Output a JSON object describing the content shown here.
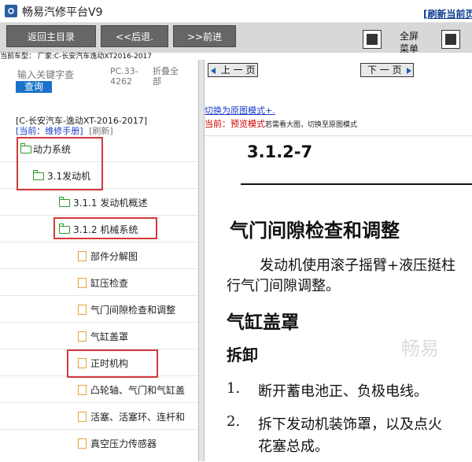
{
  "app": {
    "title": "畅易汽修平台V9"
  },
  "toolbar": {
    "home_label": "返回主目录",
    "back_label": "<<后退.",
    "forward_label": ">>前进",
    "fullscreen_label_1": "全屏",
    "fullscreen_label_2": "菜单"
  },
  "car_type": "当前车型： 厂家:C-长安汽车逸动XT2016-2017",
  "search": {
    "placeholder_line1": "输入关键字查",
    "placeholder_line2": "查询",
    "code_line1": "PC.33-",
    "code_line2": "4262",
    "collapse_line1": "折叠全",
    "collapse_line2": "部"
  },
  "breadcrumb": {
    "model": "[C-长安汽车-逸动XT-2016-2017]",
    "current_prefix": "[当前：",
    "current": "维修手册",
    "current_suffix": "]",
    "refresh": "[刷新]"
  },
  "tree": [
    {
      "label": "动力系统",
      "kind": "folder"
    },
    {
      "label": "3.1发动机",
      "kind": "folder"
    },
    {
      "label": "3.1.1 发动机概述",
      "kind": "folder"
    },
    {
      "label": "3.1.2 机械系统",
      "kind": "folder"
    },
    {
      "label": "部件分解图",
      "kind": "page"
    },
    {
      "label": "缸压检查",
      "kind": "page"
    },
    {
      "label": "气门间隙检查和调整",
      "kind": "page"
    },
    {
      "label": "气缸盖罩",
      "kind": "page"
    },
    {
      "label": "正时机构",
      "kind": "page"
    },
    {
      "label": "凸轮轴、气门和气缸盖",
      "kind": "page"
    },
    {
      "label": "活塞、活塞环、连杆和",
      "kind": "page"
    },
    {
      "label": "真空压力传感器",
      "kind": "page"
    }
  ],
  "pager": {
    "prev": "上 一 页",
    "next": "下 一 页",
    "refresh_current": "[刷新当前页"
  },
  "view": {
    "switch_link": "切换为原图模式+.",
    "mode_prefix": "当前：",
    "mode": "预览模式",
    "mode_hint": "若需看大图，切换至原图模式"
  },
  "document": {
    "section_no": "3.1.2-7",
    "heading": "气门间隙检查和调整",
    "para_line1": "发动机使用滚子摇臂+液压挺柱",
    "para_line2": "行气门间隙调整。",
    "subheading": "气缸盖罩",
    "subsubheading": "拆卸",
    "step1_no": "1.",
    "step1_text": "断开蓄电池正、负极电线。",
    "step2_no": "2.",
    "step2_line1": "拆下发动机装饰罩，以及点火",
    "step2_line2": "花塞总成。",
    "watermark": "畅易"
  },
  "colors": {
    "highlight_box": "#d33a3a",
    "folder_icon": "#2e9a2e",
    "page_icon": "#e7a23b",
    "link_blue": "#1a3cc8",
    "mode_red": "#d40000",
    "button_gray": "#666666"
  }
}
